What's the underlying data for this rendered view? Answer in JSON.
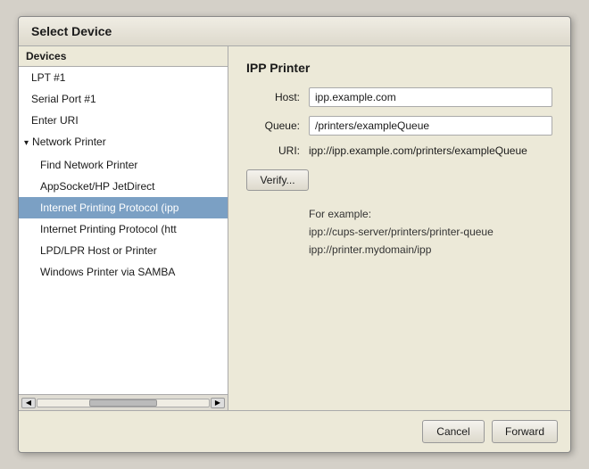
{
  "dialog": {
    "title": "Select Device",
    "left_panel": {
      "header": "Devices",
      "items": [
        {
          "id": "lpt1",
          "label": "LPT #1",
          "level": "top",
          "expandable": false
        },
        {
          "id": "serial1",
          "label": "Serial Port #1",
          "level": "top",
          "expandable": false
        },
        {
          "id": "enter-uri",
          "label": "Enter URI",
          "level": "top",
          "expandable": false
        },
        {
          "id": "network-printer",
          "label": "Network Printer",
          "level": "parent",
          "expandable": true,
          "expanded": true
        },
        {
          "id": "find-network",
          "label": "Find Network Printer",
          "level": "child",
          "expandable": false
        },
        {
          "id": "appsocket",
          "label": "AppSocket/HP JetDirect",
          "level": "child",
          "expandable": false
        },
        {
          "id": "ipp-ipp",
          "label": "Internet Printing Protocol (ipp",
          "level": "child",
          "expandable": false,
          "selected": true
        },
        {
          "id": "ipp-http",
          "label": "Internet Printing Protocol (htt",
          "level": "child",
          "expandable": false
        },
        {
          "id": "lpd-lpr",
          "label": "LPD/LPR Host or Printer",
          "level": "child",
          "expandable": false
        },
        {
          "id": "windows-samba",
          "label": "Windows Printer via SAMBA",
          "level": "child",
          "expandable": false
        }
      ]
    },
    "right_panel": {
      "title": "IPP Printer",
      "host_label": "Host:",
      "host_value": "ipp.example.com",
      "host_placeholder": "ipp.example.com",
      "queue_label": "Queue:",
      "queue_value": "/printers/exampleQueue",
      "queue_placeholder": "/printers/exampleQueue",
      "uri_label": "URI:",
      "uri_value": "ipp://ipp.example.com/printers/exampleQueue",
      "verify_label": "Verify...",
      "example_title": "For example:",
      "example_line1": "ipp://cups-server/printers/printer-queue",
      "example_line2": "ipp://printer.mydomain/ipp"
    },
    "footer": {
      "cancel_label": "Cancel",
      "forward_label": "Forward"
    }
  }
}
